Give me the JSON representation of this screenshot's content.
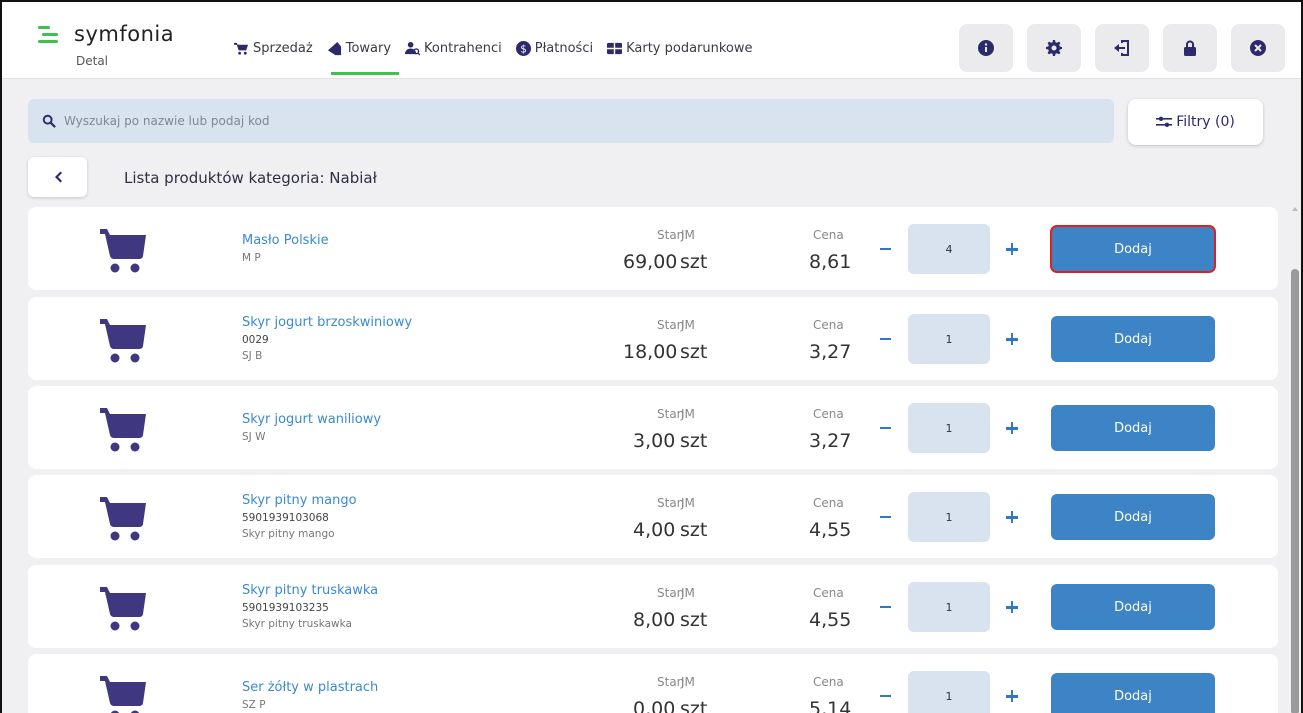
{
  "app": {
    "logo_text": "symfonia",
    "logo_sub": "Detal"
  },
  "nav": [
    {
      "label": "Sprzedaż",
      "icon": "cart-icon",
      "active": false
    },
    {
      "label": "Towary",
      "icon": "tag-icon",
      "active": true
    },
    {
      "label": "Kontrahenci",
      "icon": "contacts-icon",
      "active": false
    },
    {
      "label": "Płatności",
      "icon": "dollar-circle-icon",
      "active": false
    },
    {
      "label": "Karty podarunkowe",
      "icon": "gift-card-icon",
      "active": false
    }
  ],
  "header_buttons": [
    "info-icon",
    "gear-icon",
    "logout-icon",
    "lock-icon",
    "close-icon"
  ],
  "search": {
    "placeholder": "Wyszukaj po nazwie lub podaj kod"
  },
  "filters": {
    "label": "Filtry (0)"
  },
  "category": {
    "title": "Lista produktów kategoria: Nabiał"
  },
  "labels": {
    "stock": "Stan",
    "unit": "JM",
    "price": "Cena",
    "add": "Dodaj"
  },
  "products": [
    {
      "name": "Masło Polskie",
      "code": "",
      "shortname": "M P",
      "stock": "69,00",
      "unit": "szt",
      "price": "8,61",
      "qty": "4",
      "focused": true
    },
    {
      "name": "Skyr jogurt brzoskwiniowy",
      "code": "0029",
      "shortname": "SJ B",
      "stock": "18,00",
      "unit": "szt",
      "price": "3,27",
      "qty": "1",
      "focused": false
    },
    {
      "name": "Skyr jogurt waniliowy",
      "code": "",
      "shortname": "SJ W",
      "stock": "3,00",
      "unit": "szt",
      "price": "3,27",
      "qty": "1",
      "focused": false
    },
    {
      "name": "Skyr pitny mango",
      "code": "5901939103068",
      "shortname": "Skyr pitny mango",
      "stock": "4,00",
      "unit": "szt",
      "price": "4,55",
      "qty": "1",
      "focused": false
    },
    {
      "name": "Skyr pitny truskawka",
      "code": "5901939103235",
      "shortname": "Skyr pitny truskawka",
      "stock": "8,00",
      "unit": "szt",
      "price": "4,55",
      "qty": "1",
      "focused": false
    },
    {
      "name": "Ser żółty w plastrach",
      "code": "",
      "shortname": "SZ P",
      "stock": "0,00",
      "unit": "szt",
      "price": "5,14",
      "qty": "1",
      "focused": false
    }
  ],
  "colors": {
    "accent_green": "#3ec24b",
    "brand_navy": "#2c2a6b",
    "button_blue": "#3d84c6",
    "field_bg": "#d8e3ef"
  }
}
